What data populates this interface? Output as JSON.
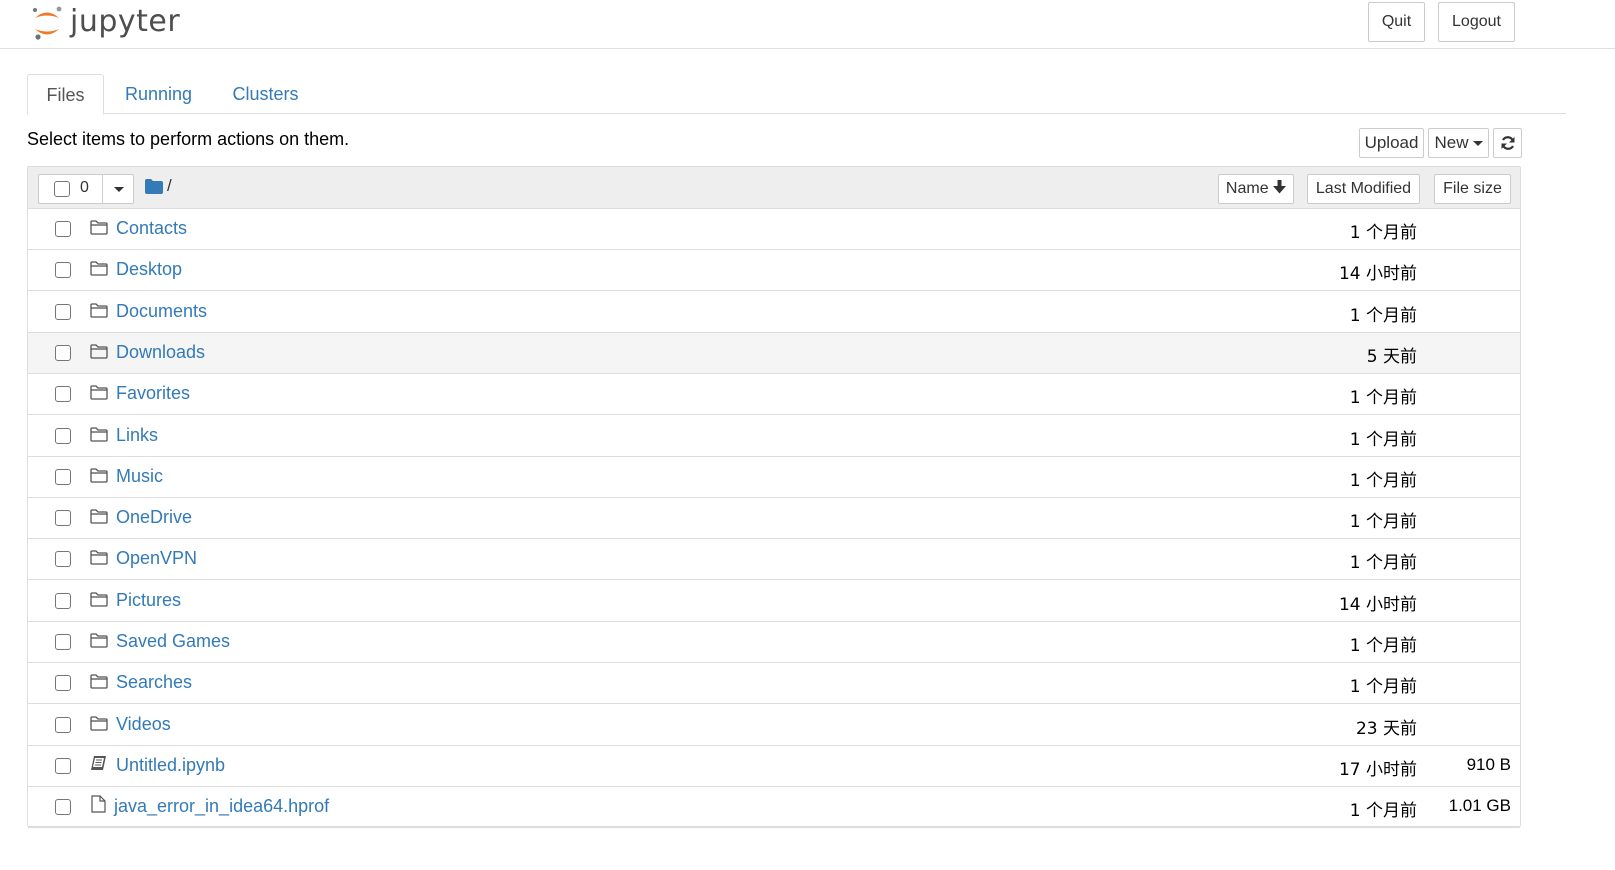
{
  "header": {
    "logo_text": "jupyter",
    "quit_label": "Quit",
    "logout_label": "Logout"
  },
  "tabs": [
    {
      "label": "Files",
      "active": true
    },
    {
      "label": "Running",
      "active": false
    },
    {
      "label": "Clusters",
      "active": false
    }
  ],
  "toolbar": {
    "instructions": "Select items to perform actions on them.",
    "upload_label": "Upload",
    "new_label": "New",
    "refresh_icon": "refresh-icon"
  },
  "list_header": {
    "selected_count": "0",
    "breadcrumb_icon": "folder-icon",
    "breadcrumb_path": "/",
    "sort_name_label": "Name",
    "sort_name_icon": "arrow-down-icon",
    "sort_modified_label": "Last Modified",
    "sort_size_label": "File size"
  },
  "items": [
    {
      "name": "Contacts",
      "type": "folder",
      "modified": "1 个月前",
      "size": ""
    },
    {
      "name": "Desktop",
      "type": "folder",
      "modified": "14 小时前",
      "size": ""
    },
    {
      "name": "Documents",
      "type": "folder",
      "modified": "1 个月前",
      "size": ""
    },
    {
      "name": "Downloads",
      "type": "folder",
      "modified": "5 天前",
      "size": ""
    },
    {
      "name": "Favorites",
      "type": "folder",
      "modified": "1 个月前",
      "size": ""
    },
    {
      "name": "Links",
      "type": "folder",
      "modified": "1 个月前",
      "size": ""
    },
    {
      "name": "Music",
      "type": "folder",
      "modified": "1 个月前",
      "size": ""
    },
    {
      "name": "OneDrive",
      "type": "folder",
      "modified": "1 个月前",
      "size": ""
    },
    {
      "name": "OpenVPN",
      "type": "folder",
      "modified": "1 个月前",
      "size": ""
    },
    {
      "name": "Pictures",
      "type": "folder",
      "modified": "14 小时前",
      "size": ""
    },
    {
      "name": "Saved Games",
      "type": "folder",
      "modified": "1 个月前",
      "size": ""
    },
    {
      "name": "Searches",
      "type": "folder",
      "modified": "1 个月前",
      "size": ""
    },
    {
      "name": "Videos",
      "type": "folder",
      "modified": "23 天前",
      "size": ""
    },
    {
      "name": "Untitled.ipynb",
      "type": "notebook",
      "modified": "17 小时前",
      "size": "910 B"
    },
    {
      "name": "java_error_in_idea64.hprof",
      "type": "file",
      "modified": "1 个月前",
      "size": "1.01 GB"
    }
  ],
  "colors": {
    "link": "#337ab7",
    "logo_orange": "#f37726",
    "folder_blue": "#337ab7"
  }
}
